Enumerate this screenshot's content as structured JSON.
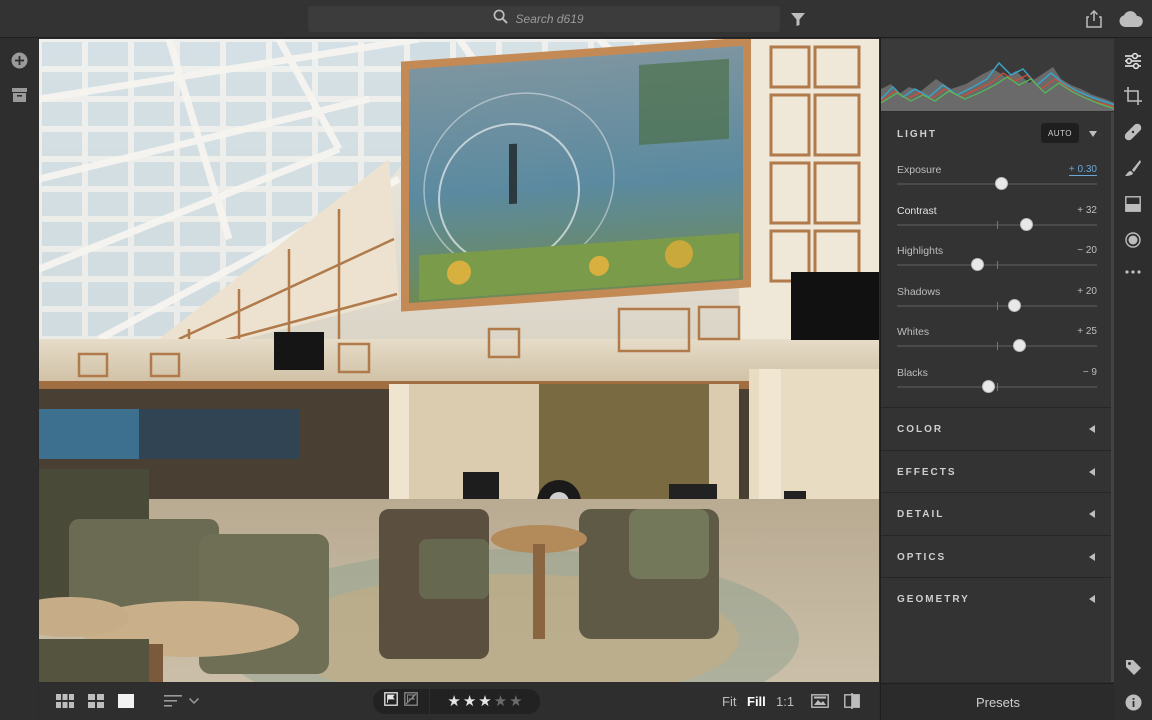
{
  "search": {
    "placeholder": "Search d619"
  },
  "icons": {
    "search": "search-icon",
    "filter": "filter-icon",
    "share": "share-icon",
    "cloud": "cloud-icon",
    "add": "add-photo-icon",
    "archive": "archive-icon"
  },
  "edit_panel": {
    "light": {
      "title": "LIGHT",
      "auto_label": "AUTO",
      "sliders": [
        {
          "label": "Exposure",
          "value": "+ 0.30",
          "position": 0.52
        },
        {
          "label": "Contrast",
          "value": "+ 32",
          "position": 0.645
        },
        {
          "label": "Highlights",
          "value": "− 20",
          "position": 0.4
        },
        {
          "label": "Shadows",
          "value": "+ 20",
          "position": 0.585
        },
        {
          "label": "Whites",
          "value": "+ 25",
          "position": 0.61
        },
        {
          "label": "Blacks",
          "value": "− 9",
          "position": 0.455
        }
      ]
    },
    "sections": [
      "COLOR",
      "EFFECTS",
      "DETAIL",
      "OPTICS",
      "GEOMETRY"
    ],
    "presets_label": "Presets"
  },
  "bottom_bar": {
    "zoom": {
      "fit": "Fit",
      "fill": "Fill",
      "one_to_one": "1:1"
    },
    "rating": {
      "stars": 3,
      "max": 5
    }
  },
  "colors": {
    "accent_link": "#6aa7d8",
    "panel_bg": "#333333"
  }
}
